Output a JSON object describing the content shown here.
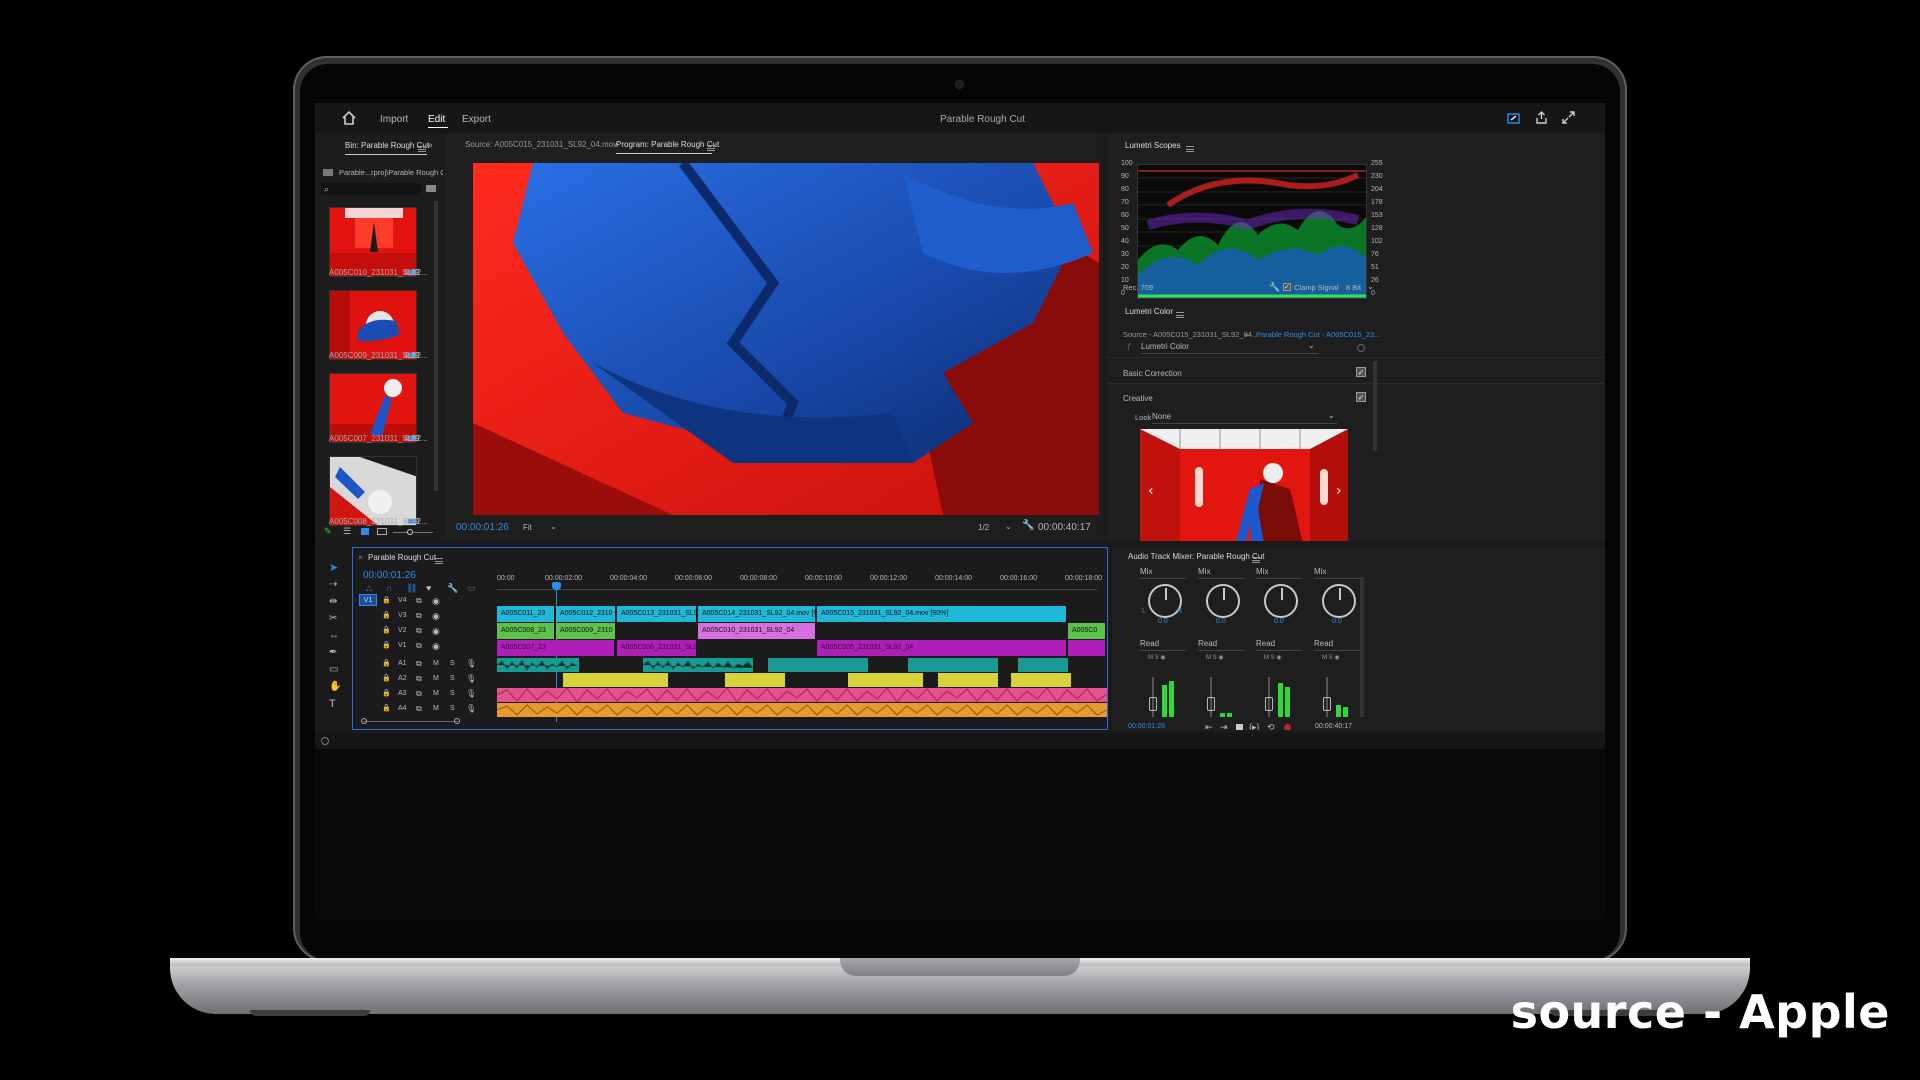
{
  "window": {
    "title": "Parable Rough Cut"
  },
  "nav": {
    "import": "Import",
    "edit": "Edit",
    "export": "Export"
  },
  "bin": {
    "tab": "Bin: Parable Rough Cut",
    "path": "Parable...rproj\\Parable Rough Cut",
    "clips": [
      {
        "name": "A005C010_231031_SL92...",
        "duration": "4;29"
      },
      {
        "name": "A005C009_231031_SL92...",
        "duration": "4;29"
      },
      {
        "name": "A005C007_231031_SL92...",
        "duration": "4;29"
      },
      {
        "name": "A005C008_231031_SL92...",
        "duration": "4;29"
      }
    ]
  },
  "monitor": {
    "source_tab": "Source: A005C015_231031_SL92_04.mov",
    "program_tab": "Program: Parable Rough Cut",
    "timecode": "00:00:01:26",
    "fit": "Fit",
    "resolution": "1/2",
    "duration": "00:00:40:17"
  },
  "scopes": {
    "title": "Lumetri Scopes",
    "left_ticks": [
      "100",
      "90",
      "80",
      "70",
      "60",
      "50",
      "40",
      "30",
      "20",
      "10",
      "0"
    ],
    "right_ticks": [
      "255",
      "230",
      "204",
      "178",
      "153",
      "128",
      "102",
      "76",
      "51",
      "26",
      "0"
    ],
    "standard": "Rec. 709",
    "clamp": "Clamp Signal",
    "bit": "8 Bit"
  },
  "lumetri": {
    "title": "Lumetri Color",
    "source": "Source - A005C015_231031_SL92_04...",
    "target": "Parable Rough Cut - A005C015_23...",
    "preset": "Lumetri Color",
    "basic": "Basic Correction",
    "creative": "Creative",
    "look_label": "Look",
    "look_value": "None"
  },
  "timeline": {
    "title": "Parable Rough Cut",
    "timecode": "00:00:01:26",
    "ruler": [
      "00:00",
      "00:00:02:00",
      "00:00:04:00",
      "00:00:06:00",
      "00:00:08:00",
      "00:00:10:00",
      "00:00:12:00",
      "00:00:14:00",
      "00:00:16:00",
      "00:00:18:00"
    ],
    "tracks": [
      "V4",
      "V3",
      "V2",
      "V1",
      "A1",
      "A2",
      "A3",
      "A4"
    ],
    "v1_patch": "V1",
    "clips_v4": [
      "A005C011_23",
      "A005C012_2310",
      "A005C013_231031_SL92",
      "A005C014_231031_SL92_04.mov [90%]",
      "A005C015_231031_SL92_04.mov [90%]"
    ],
    "clips_v3": [
      "A005C008_23",
      "A005C009_2310",
      "A005C010_231031_SL92_04",
      "A005C0"
    ],
    "clips_v2": [
      "A005C007_23",
      "A005C006_231031_SL92",
      "A005C005_231031_SL92_04"
    ]
  },
  "mixer": {
    "title": "Audio Track Mixer: Parable Rough Cut",
    "channels": [
      {
        "mode": "Mix",
        "value": "0.0",
        "auto": "Read"
      },
      {
        "mode": "Mix",
        "value": "0.0",
        "auto": "Read"
      },
      {
        "mode": "Mix",
        "value": "0.0",
        "auto": "Read"
      },
      {
        "mode": "Mix",
        "value": "0.0",
        "auto": "Read"
      }
    ],
    "timecode_left": "00:00:01:26",
    "timecode_right": "00:00:40:17"
  },
  "watermark": "source - Apple",
  "colors": {
    "accent": "#2d8ceb",
    "cyan": "#20b8d8",
    "green": "#5dc24a",
    "magenta": "#b01eb8",
    "teal": "#1a9a94",
    "yellow": "#d7d23a",
    "pink": "#e5508f",
    "orange": "#e89a2c"
  }
}
